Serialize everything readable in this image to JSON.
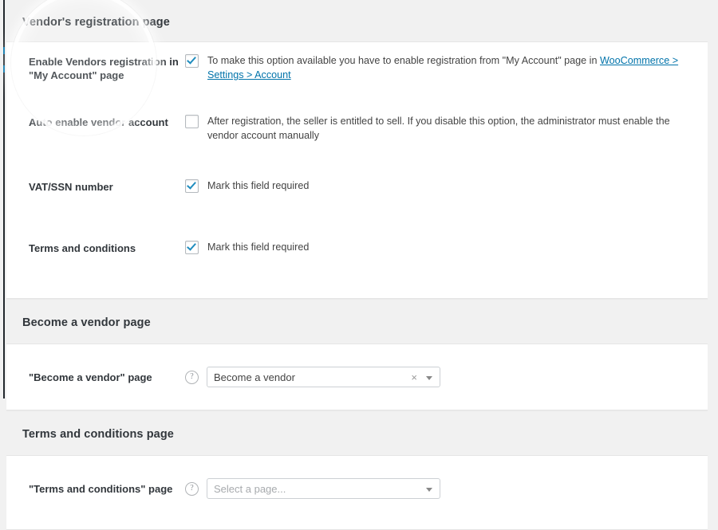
{
  "sections": [
    {
      "heading": "Vendor's registration page",
      "rows": [
        {
          "label": "Enable Vendors registration in \"My Account\" page",
          "type": "checkbox",
          "checked": true,
          "text_before": "To make this option available you have to enable registration from \"My Account\" page in ",
          "link_text": "WooCommerce > Settings > Account",
          "text_after": ""
        },
        {
          "label": "Auto enable vendor account",
          "type": "checkbox",
          "checked": false,
          "text_before": "After registration, the seller is entitled to sell. If you disable this option, the administrator must enable the vendor account manually",
          "link_text": "",
          "text_after": ""
        },
        {
          "label": "VAT/SSN number",
          "type": "checkbox",
          "checked": true,
          "text_before": "Mark this field required",
          "link_text": "",
          "text_after": ""
        },
        {
          "label": "Terms and conditions",
          "type": "checkbox",
          "checked": true,
          "text_before": "Mark this field required",
          "link_text": "",
          "text_after": ""
        }
      ]
    },
    {
      "heading": "Become a vendor page",
      "rows": [
        {
          "label": "\"Become a vendor\" page",
          "type": "select",
          "help_icon": "question-mark-icon",
          "value": "Become a vendor",
          "placeholder": "",
          "is_placeholder": false,
          "clear_label": "×",
          "has_clear": true
        }
      ]
    },
    {
      "heading": "Terms and conditions page",
      "rows": [
        {
          "label": "\"Terms and conditions\" page",
          "type": "select",
          "help_icon": "question-mark-icon",
          "value": "",
          "placeholder": "Select a page...",
          "is_placeholder": true,
          "clear_label": "",
          "has_clear": false
        }
      ]
    }
  ],
  "colors": {
    "accent": "#0073aa",
    "checkbox_check": "#1e8cbe",
    "page_background": "#f1f1f1",
    "panel_background": "#ffffff",
    "admin_bar": "#23282d"
  },
  "overlay": {
    "name": "spotlight-highlight-circle"
  }
}
